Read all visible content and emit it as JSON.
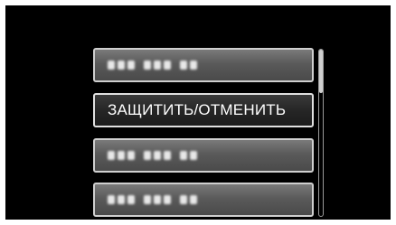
{
  "menu": {
    "items": [
      {
        "label": "",
        "state": "obscured"
      },
      {
        "label": "ЗАЩИТИТЬ/ОТМЕНИТЬ",
        "state": "selected"
      },
      {
        "label": "",
        "state": "obscured"
      },
      {
        "label": "",
        "state": "obscured"
      }
    ]
  },
  "scrollbar": {
    "position_fraction": 0.0,
    "visible_fraction": 0.26
  },
  "colors": {
    "screen_background": "#000000",
    "item_border": "#cfcfcf",
    "item_text": "#ffffff"
  }
}
